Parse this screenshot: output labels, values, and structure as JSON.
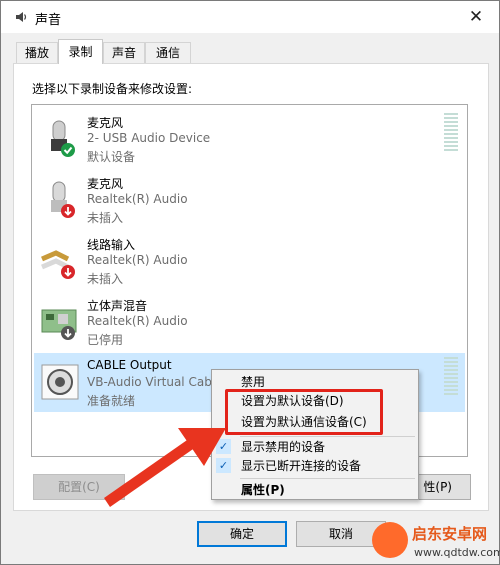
{
  "window": {
    "title": "声音",
    "close_glyph": "✕"
  },
  "tabs": [
    "播放",
    "录制",
    "声音",
    "通信"
  ],
  "instruction": "选择以下录制设备来修改设置:",
  "devices": [
    {
      "name": "麦克风",
      "desc": "2- USB Audio Device",
      "status": "默认设备",
      "icon": "microphone-icon",
      "badge": "default-check-icon"
    },
    {
      "name": "麦克风",
      "desc": "Realtek(R) Audio",
      "status": "未插入",
      "icon": "microphone-icon",
      "badge": "unplugged-arrow-icon"
    },
    {
      "name": "线路输入",
      "desc": "Realtek(R) Audio",
      "status": "未插入",
      "icon": "line-in-jack-icon",
      "badge": "unplugged-arrow-icon"
    },
    {
      "name": "立体声混音",
      "desc": "Realtek(R) Audio",
      "status": "已停用",
      "icon": "sound-card-icon",
      "badge": "disabled-arrow-icon"
    },
    {
      "name": "CABLE Output",
      "desc": "VB-Audio Virtual Cabl",
      "status": "准备就绪",
      "icon": "cable-output-icon",
      "badge": ""
    }
  ],
  "buttons": {
    "configure": "配置(C)",
    "properties": "性(P)",
    "ok": "确定",
    "cancel": "取消"
  },
  "context_menu": {
    "disable": "禁用",
    "set_default": "设置为默认设备(D)",
    "set_default_comm": "设置为默认通信设备(C)",
    "show_disabled": "显示禁用的设备",
    "show_disconnected": "显示已断开连接的设备",
    "properties": "属性(P)",
    "check_glyph": "✓"
  },
  "watermark": {
    "name": "启东安卓网",
    "url": "www.qdtdw.com"
  },
  "colors": {
    "highlight": "#e2231a",
    "selected": "#cce8ff",
    "default_button": "#0078d7",
    "arrow": "#e8341f"
  }
}
